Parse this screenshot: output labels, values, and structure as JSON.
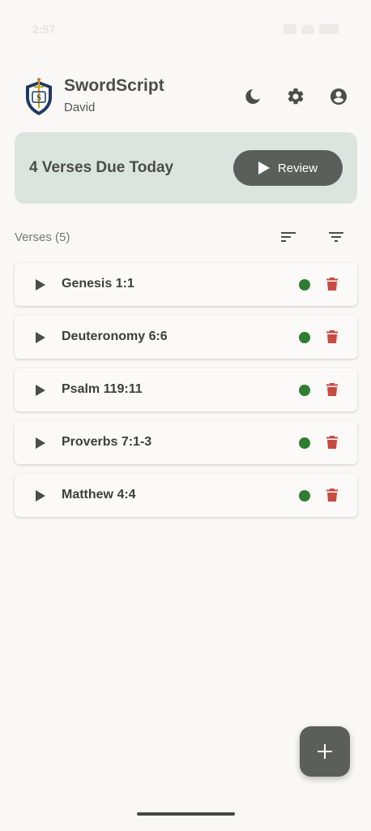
{
  "status_bar": {
    "time": "2:57",
    "icons": [
      "signal-icon",
      "wifi-icon",
      "battery-icon"
    ]
  },
  "header": {
    "app_title": "SwordScript",
    "user_name": "David",
    "icons": {
      "logo": "sword-shield-logo",
      "theme": "moon-icon",
      "settings": "gear-icon",
      "account": "account-circle-icon"
    }
  },
  "due_card": {
    "text": "4 Verses Due Today",
    "review_label": "Review",
    "background": "#dbe5de"
  },
  "verses": {
    "header_label": "Verses (5)",
    "items": [
      {
        "reference": "Genesis 1:1",
        "status_color": "#2e7d32"
      },
      {
        "reference": "Deuteronomy 6:6",
        "status_color": "#2e7d32"
      },
      {
        "reference": "Psalm 119:11",
        "status_color": "#2e7d32"
      },
      {
        "reference": "Proverbs 7:1-3",
        "status_color": "#2e7d32"
      },
      {
        "reference": "Matthew 4:4",
        "status_color": "#2e7d32"
      }
    ]
  },
  "colors": {
    "primary_dark": "#5a5f5c",
    "status_green": "#2e7d32",
    "delete_red": "#c94a42",
    "background": "#f9f8f6"
  }
}
